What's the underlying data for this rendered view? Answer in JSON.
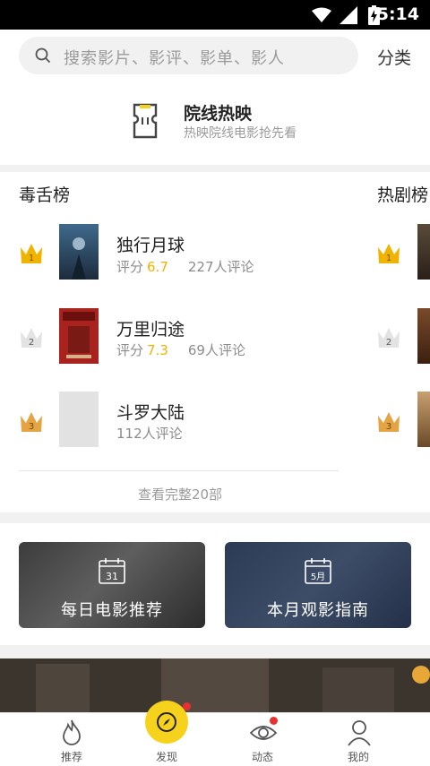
{
  "status_bar": {
    "time": "5:14"
  },
  "search": {
    "placeholder": "搜索影片、影评、影单、影人",
    "category_label": "分类"
  },
  "cinema": {
    "title": "院线热映",
    "subtitle": "热映院线电影抢先看"
  },
  "rankings": [
    {
      "title": "毒舌榜",
      "items": [
        {
          "rank": "1",
          "title": "独行月球",
          "score_label": "评分",
          "score": "6.7",
          "reviews": "227人评论"
        },
        {
          "rank": "2",
          "title": "万里归途",
          "score_label": "评分",
          "score": "7.3",
          "reviews": "69人评论"
        },
        {
          "rank": "3",
          "title": "斗罗大陆",
          "reviews": "112人评论"
        }
      ],
      "view_all": "查看完整20部"
    },
    {
      "title": "热剧榜",
      "items": [
        {
          "rank": "1"
        },
        {
          "rank": "2"
        },
        {
          "rank": "3"
        }
      ]
    }
  ],
  "cards": [
    {
      "label": "每日电影推荐",
      "calendar_day": "31"
    },
    {
      "label": "本月观影指南",
      "calendar_day": "5月"
    }
  ],
  "nav": [
    {
      "label": "推荐",
      "icon": "flame-icon"
    },
    {
      "label": "发现",
      "icon": "compass-icon"
    },
    {
      "label": "动态",
      "icon": "eye-icon"
    },
    {
      "label": "我的",
      "icon": "profile-icon"
    }
  ],
  "colors": {
    "accent_yellow": "#f7d21c",
    "score_orange": "#f0b400",
    "gold_crown": "#f0b400",
    "silver_crown": "#e3e3e3",
    "bronze_crown": "#e4a443",
    "red_dot": "#e8312f"
  }
}
